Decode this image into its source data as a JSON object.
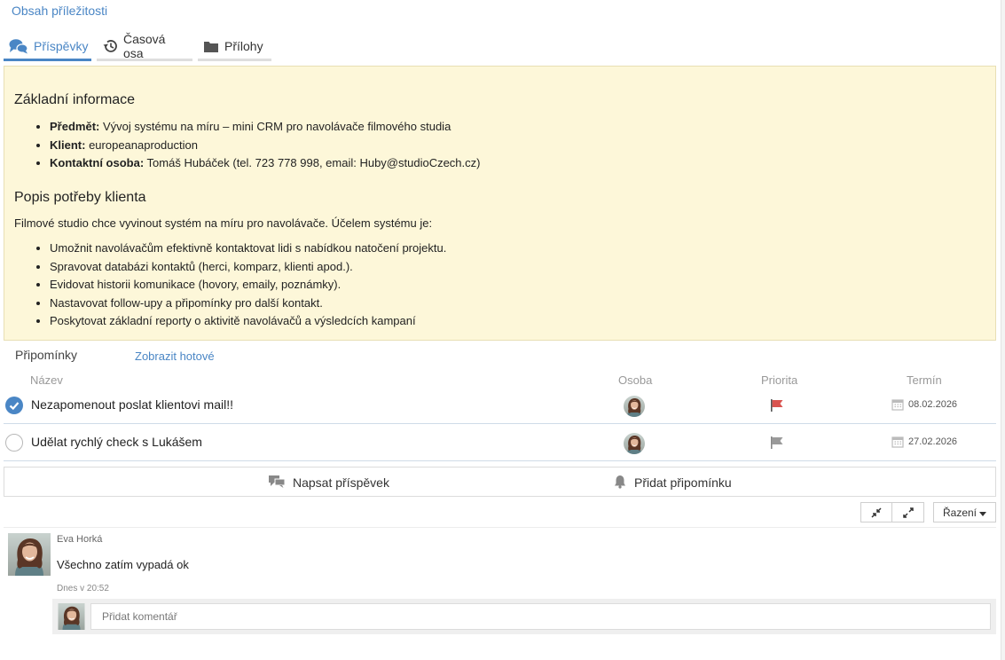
{
  "page": {
    "title": "Obsah příležitosti"
  },
  "tabs": [
    {
      "label": "Příspěvky",
      "icon": "comments-icon",
      "active": true
    },
    {
      "label": "Časová osa",
      "icon": "history-icon",
      "active": false
    },
    {
      "label": "Přílohy",
      "icon": "folder-icon",
      "active": false
    }
  ],
  "info": {
    "basic_heading": "Základní informace",
    "basic_items": [
      {
        "key": "Předmět:",
        "value": " Vývoj systému na míru – mini CRM pro navolávače filmového studia"
      },
      {
        "key": "Klient:",
        "value": " europeanaproduction"
      },
      {
        "key": "Kontaktní osoba:",
        "value": " Tomáš Hubáček (tel. 723 778 998, email: Huby@studioCzech.cz)"
      }
    ],
    "needs_heading": "Popis potřeby klienta",
    "needs_intro": "Filmové studio chce vyvinout systém na míru pro navolávače. Účelem systému je:",
    "needs_items": [
      "Umožnit navolávačům efektivně kontaktovat lidi s nabídkou natočení projektu.",
      "Spravovat databázi kontaktů (herci, komparz, klienti apod.).",
      "Evidovat historii komunikace (hovory, emaily, poznámky).",
      "Nastavovat follow-upy a připomínky pro další kontakt.",
      "Poskytovat základní reporty o aktivitě navolávačů a výsledcích kampaní"
    ],
    "background_color": "#fdf7d9"
  },
  "reminders": {
    "heading": "Připomínky",
    "show_done": "Zobrazit hotové",
    "columns": {
      "name": "Název",
      "person": "Osoba",
      "priority": "Priorita",
      "due": "Termín"
    },
    "rows": [
      {
        "title": "Nezapomenout poslat klientovi mail!!",
        "done": true,
        "priority_color": "#d9534f",
        "due": "08.02.2026"
      },
      {
        "title": "Udělat rychlý check s Lukášem",
        "done": false,
        "priority_color": "#9a9a9a",
        "due": "27.02.2026"
      }
    ]
  },
  "actions": {
    "write_post": "Napsat příspěvek",
    "add_reminder": "Přidat připomínku"
  },
  "toolbar": {
    "sort_label": "Řazení"
  },
  "post": {
    "author": "Eva Horká",
    "text": "Všechno zatím vypadá ok",
    "time": "Dnes v 20:52",
    "comment_placeholder": "Přidat komentář"
  },
  "colors": {
    "accent": "#4a86c5",
    "priority_high": "#d9534f",
    "priority_normal": "#9a9a9a"
  }
}
